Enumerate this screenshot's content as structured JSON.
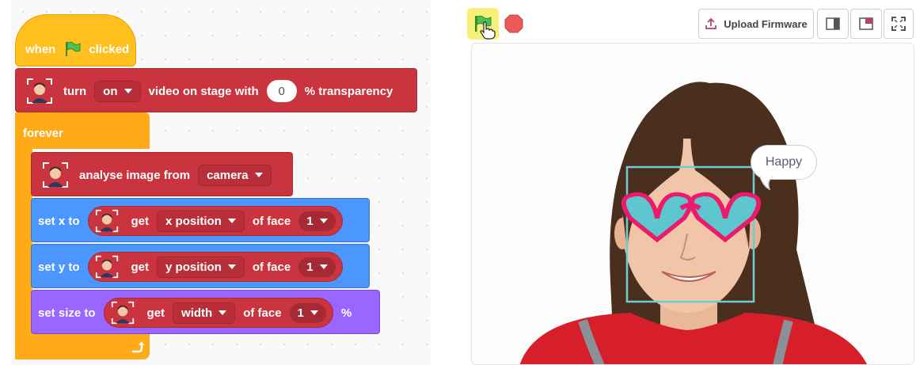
{
  "code": {
    "when_block": {
      "prefix": "when",
      "suffix": "clicked",
      "flag_icon": "green-flag-icon"
    },
    "video_block": {
      "verb": "turn",
      "state": "on",
      "middle": "video on stage with",
      "transparency": "0",
      "suffix": "% transparency"
    },
    "forever_block": {
      "label": "forever",
      "loop_arrow_icon": "loop-arrow-icon"
    },
    "analyse_block": {
      "label": "analyse image from",
      "source": "camera"
    },
    "set_x_block": {
      "label": "set x to",
      "get": "get",
      "property": "x position",
      "of_face": "of face",
      "face_num": "1"
    },
    "set_y_block": {
      "label": "set y to",
      "get": "get",
      "property": "y position",
      "of_face": "of face",
      "face_num": "1"
    },
    "set_size_block": {
      "label": "set size to",
      "get": "get",
      "property": "width",
      "of_face": "of face",
      "face_num": "1",
      "suffix": "%"
    }
  },
  "stage_controls": {
    "green_flag_icon": "green-flag-icon",
    "stop_icon": "stop-icon",
    "upload_label": "Upload Firmware",
    "layout_small_icon": "small-stage-icon",
    "layout_large_icon": "large-stage-icon",
    "fullscreen_icon": "fullscreen-icon"
  },
  "stage": {
    "speech_bubble": "Happy",
    "face_box_color": "#6ccdd0",
    "glasses_frame_color": "#ea1b6b",
    "glasses_lens_color": "#5ec6cf"
  },
  "colors": {
    "event": "#ffbf1f",
    "face_ext": "#c9343e",
    "motion": "#4c97ff",
    "looks": "#9966ff",
    "control": "#ffab19"
  }
}
